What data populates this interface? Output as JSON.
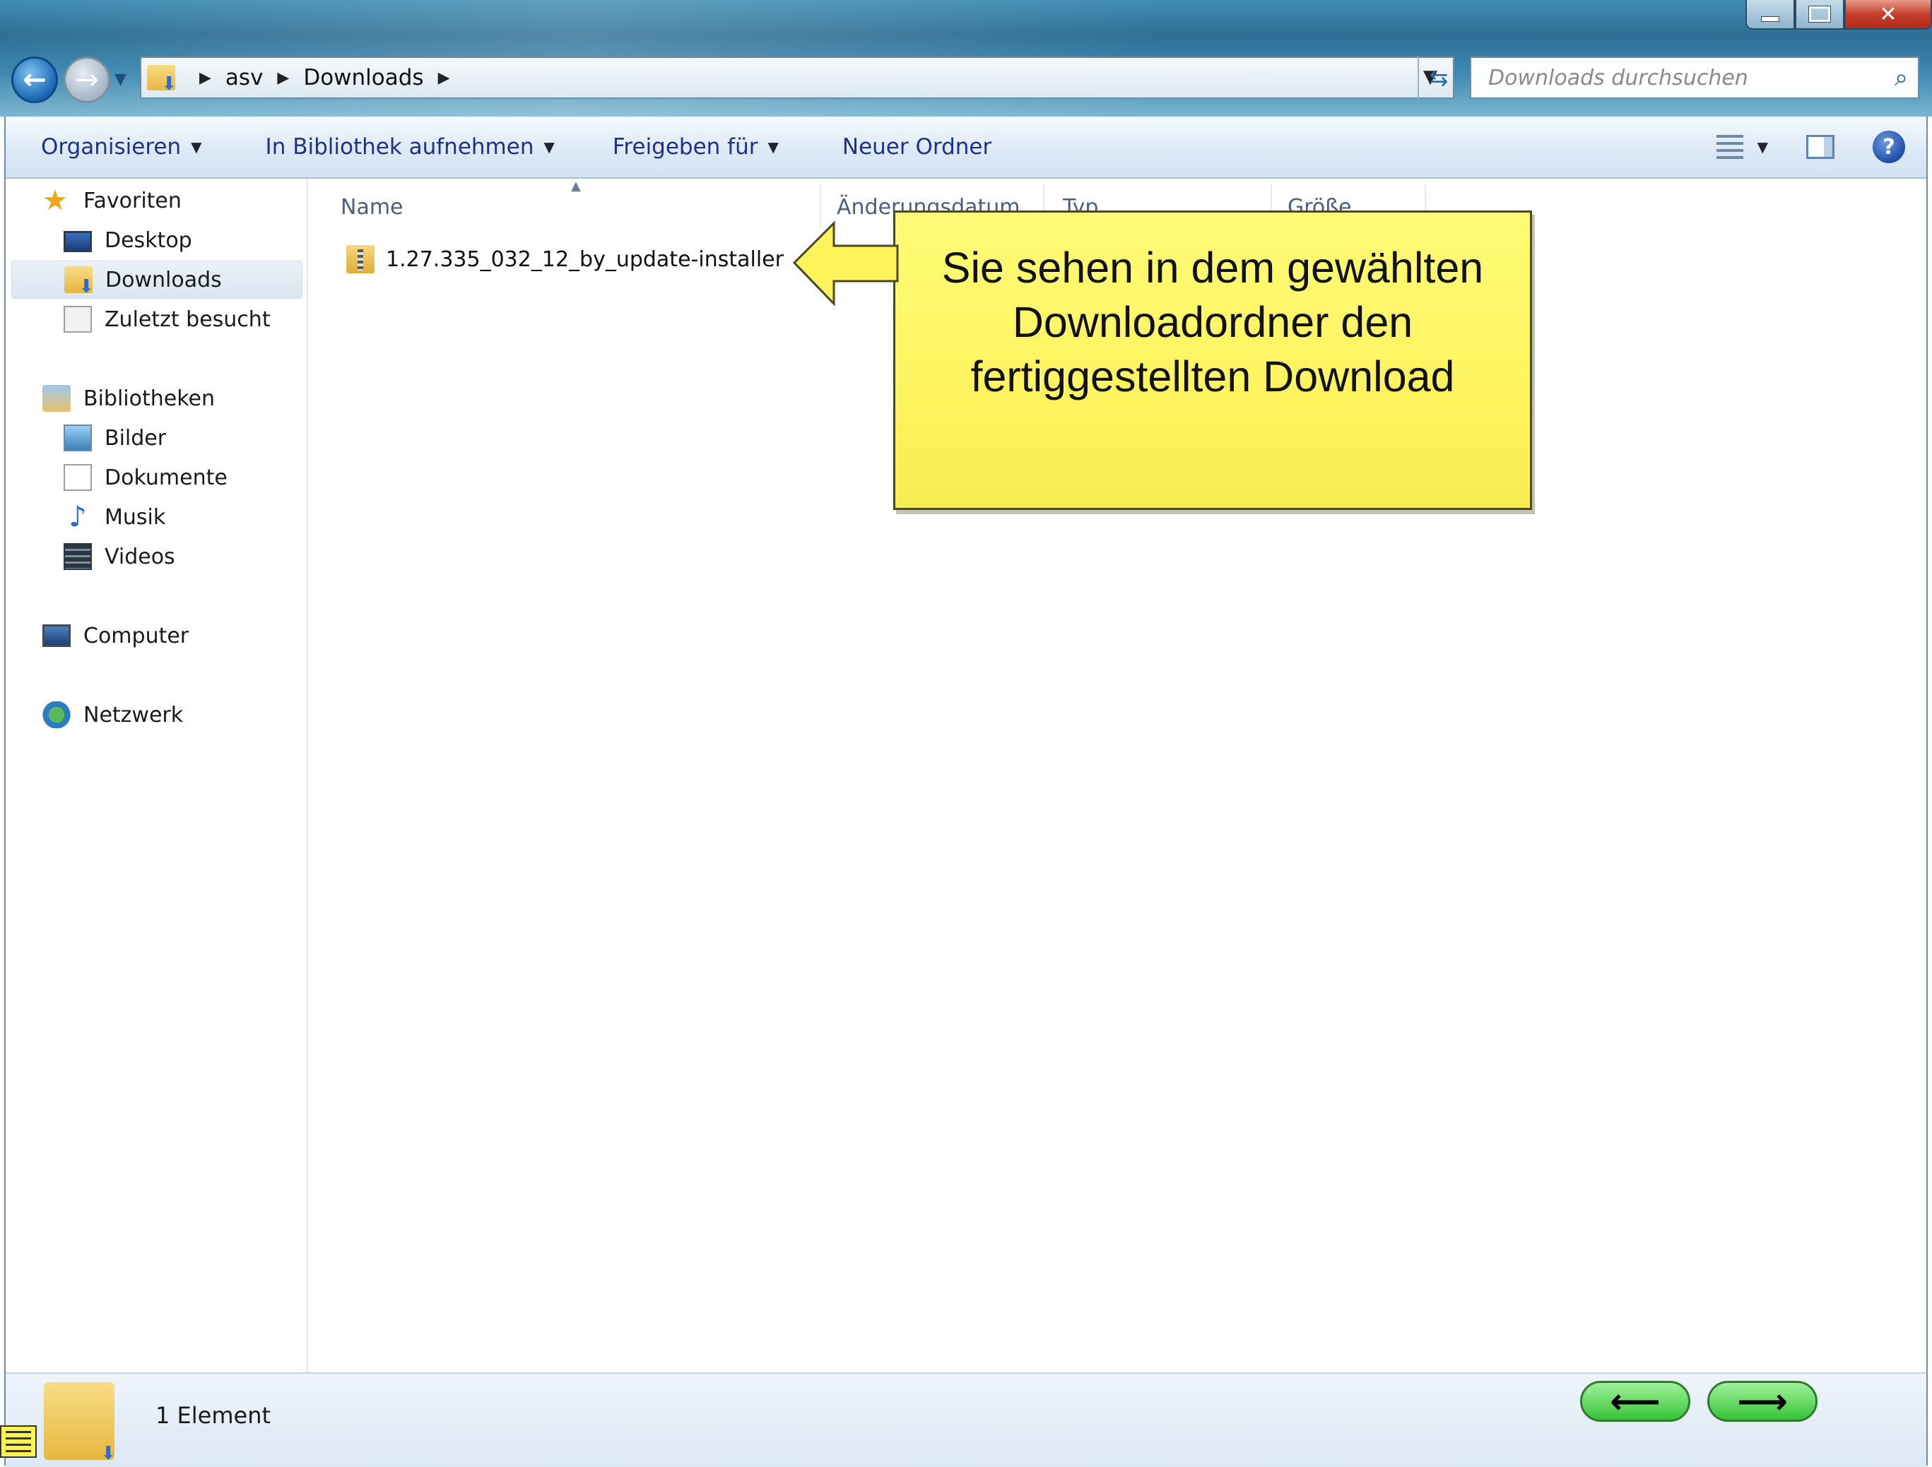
{
  "window": {
    "close_glyph": "✕"
  },
  "nav": {
    "breadcrumb": [
      "asv",
      "Downloads"
    ],
    "search_placeholder": "Downloads durchsuchen"
  },
  "toolbar": {
    "organize": "Organisieren",
    "library": "In Bibliothek aufnehmen",
    "share": "Freigeben für",
    "new_folder": "Neuer Ordner"
  },
  "sidebar": {
    "favorites": "Favoriten",
    "desktop": "Desktop",
    "downloads": "Downloads",
    "recent": "Zuletzt besucht",
    "libraries": "Bibliotheken",
    "pictures": "Bilder",
    "documents": "Dokumente",
    "music": "Musik",
    "videos": "Videos",
    "computer": "Computer",
    "network": "Netzwerk"
  },
  "columns": {
    "name": "Name",
    "date": "Änderungsdatum",
    "type": "Typ",
    "size": "Größe"
  },
  "files": [
    {
      "name": "1.27.335_032_12_by_update-installer"
    }
  ],
  "callout": {
    "line1": "Sie sehen in dem gewählten",
    "line2": "Downloadordner den",
    "line3": "fertiggestellten Download"
  },
  "status": {
    "count": "1 Element"
  },
  "tutorial_nav": {
    "prev": "⟵",
    "next": "⟶"
  },
  "colors": {
    "callout_bg": "#fff35c",
    "nav_pill": "#37c437",
    "link_text": "#1e3287"
  }
}
